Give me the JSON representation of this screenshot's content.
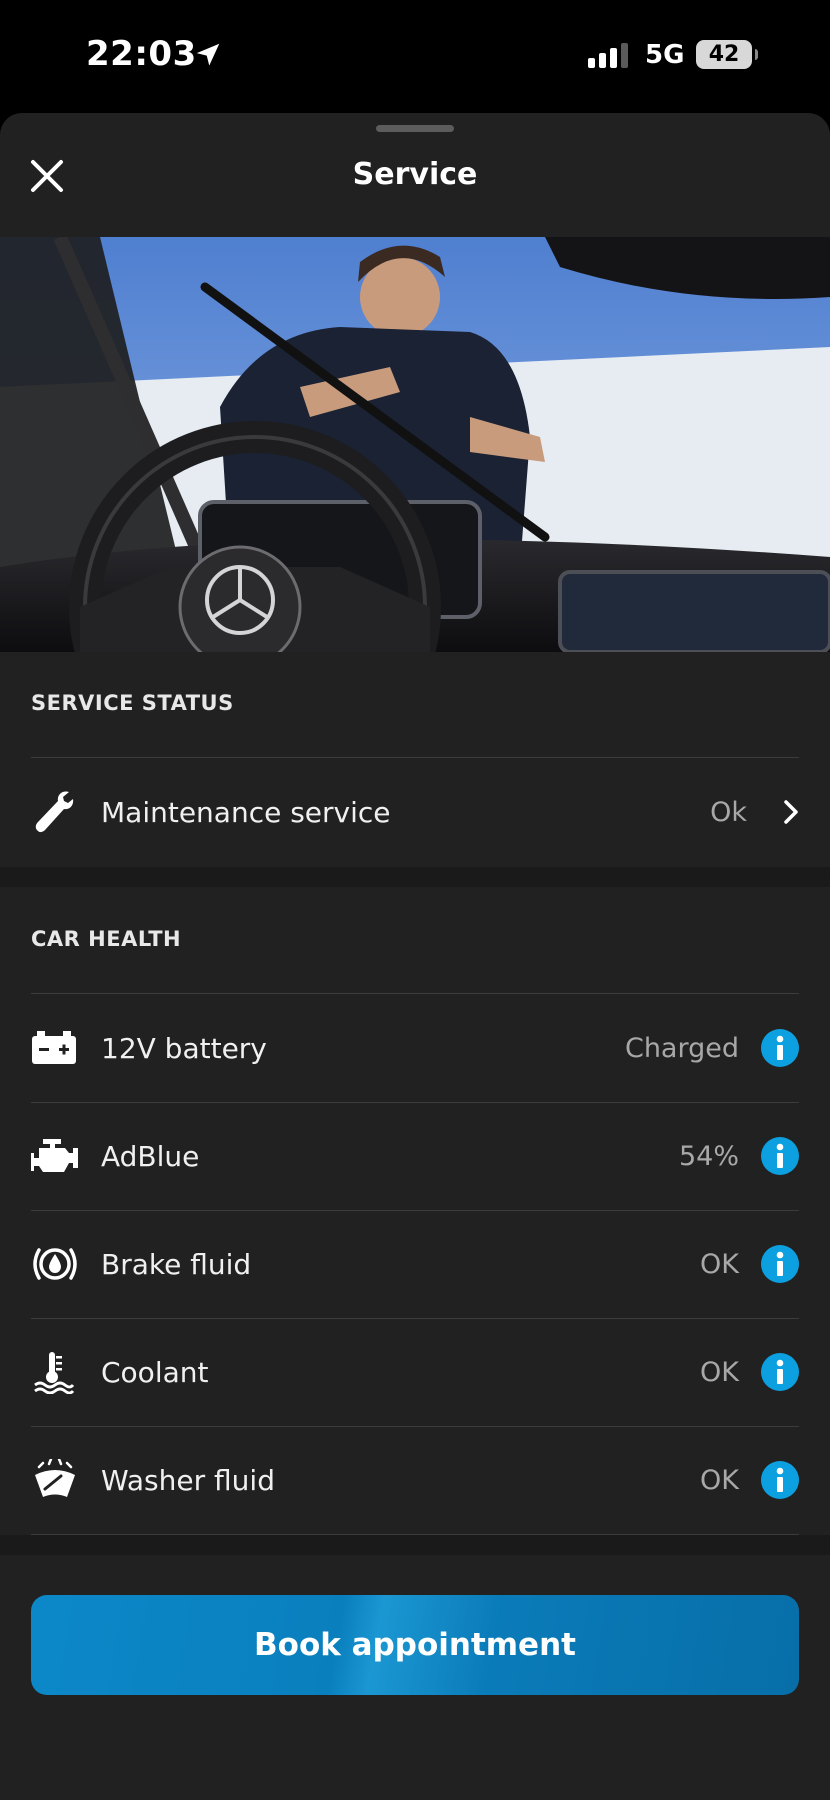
{
  "status_bar": {
    "time": "22:03",
    "network": "5G",
    "battery": "42"
  },
  "header": {
    "title": "Service"
  },
  "service_status": {
    "section_label": "SERVICE STATUS",
    "items": [
      {
        "label": "Maintenance service",
        "value": "Ok",
        "icon": "wrench-icon"
      }
    ]
  },
  "car_health": {
    "section_label": "CAR HEALTH",
    "items": [
      {
        "label": "12V battery",
        "value": "Charged",
        "icon": "battery-icon"
      },
      {
        "label": "AdBlue",
        "value": "54%",
        "icon": "engine-icon"
      },
      {
        "label": "Brake fluid",
        "value": "OK",
        "icon": "brake-fluid-icon"
      },
      {
        "label": "Coolant",
        "value": "OK",
        "icon": "coolant-icon"
      },
      {
        "label": "Washer fluid",
        "value": "OK",
        "icon": "washer-fluid-icon"
      }
    ]
  },
  "actions": {
    "book_label": "Book appointment"
  },
  "colors": {
    "accent": "#0ca0e0",
    "button": "#0a7fbe",
    "background": "#212121"
  }
}
